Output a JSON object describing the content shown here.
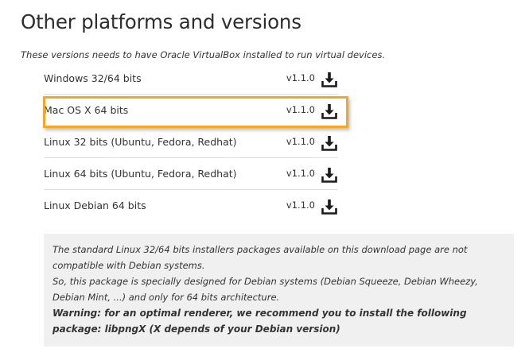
{
  "header": {
    "title": "Other platforms and versions",
    "subtitle": "These versions needs to have Oracle VirtualBox installed to run virtual devices."
  },
  "platforms": [
    {
      "name": "Windows 32/64 bits",
      "version": "v1.1.0",
      "icon": "download-icon"
    },
    {
      "name": "Mac OS X 64 bits",
      "version": "v1.1.0",
      "icon": "download-icon",
      "highlighted": true
    },
    {
      "name": "Linux 32 bits (Ubuntu, Fedora, Redhat)",
      "version": "v1.1.0",
      "icon": "download-icon"
    },
    {
      "name": "Linux 64 bits (Ubuntu, Fedora, Redhat)",
      "version": "v1.1.0",
      "icon": "download-icon"
    },
    {
      "name": "Linux Debian 64 bits",
      "version": "v1.1.0",
      "icon": "download-icon"
    }
  ],
  "notice": {
    "line1": "The standard Linux 32/64 bits installers packages available on this download page are not compatible with Debian systems.",
    "line2": "So, this package is specially designed for Debian systems (Debian Squeeze, Debian Wheezy, Debian Mint, ...) and only for 64 bits architecture.",
    "warning": "Warning: for an optimal renderer, we recommend you to install the following package: libpngX (X depends of your Debian version)"
  },
  "colors": {
    "highlight": "#f5a623",
    "notice_background": "#f0f0f0",
    "text": "#333333"
  }
}
